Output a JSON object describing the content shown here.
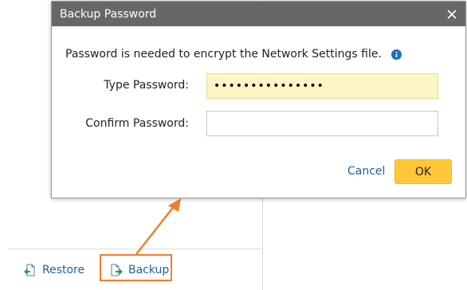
{
  "dialog": {
    "title": "Backup Password",
    "message": "Password is needed to encrypt the Network Settings file.",
    "type_password_label": "Type Password:",
    "type_password_value": "•••••••••••••••",
    "confirm_password_label": "Confirm Password:",
    "confirm_password_value": "",
    "cancel_label": "Cancel",
    "ok_label": "OK"
  },
  "background": {
    "restore_label": "Restore",
    "backup_label": "Backup"
  },
  "colors": {
    "titlebar": "#676767",
    "accent": "#ffc838",
    "link": "#1f5fa8",
    "callout": "#f07f2a",
    "highlight_field": "#fdf6c4"
  },
  "icons": {
    "close": "close-icon",
    "info": "info-icon",
    "restore": "restore-icon",
    "backup": "backup-icon"
  }
}
